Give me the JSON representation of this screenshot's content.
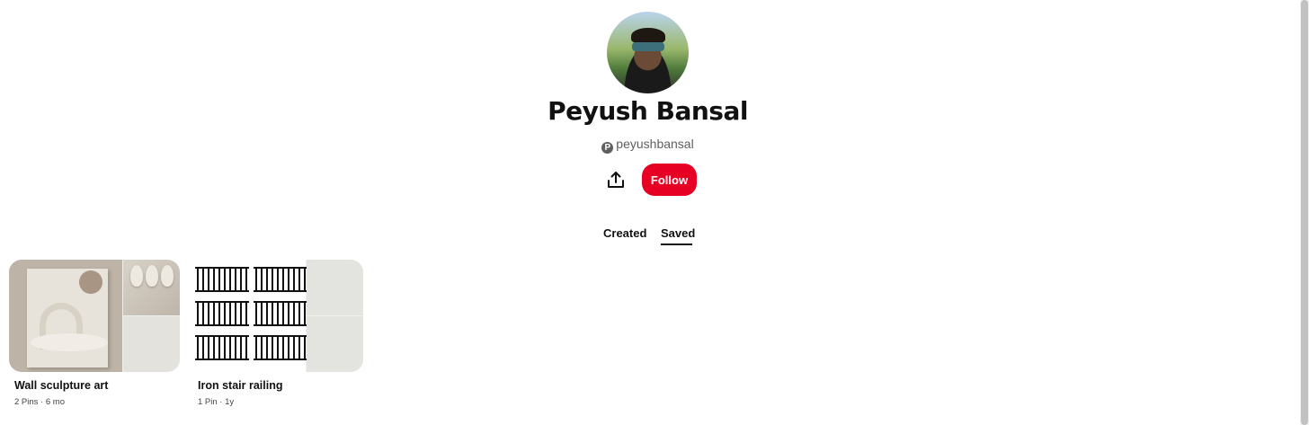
{
  "profile": {
    "name": "Peyush Bansal",
    "handle": "peyushbansal",
    "follow_label": "Follow"
  },
  "tabs": [
    {
      "label": "Created",
      "active": false
    },
    {
      "label": "Saved",
      "active": true
    }
  ],
  "boards": [
    {
      "title": "Wall sculpture art",
      "pins": "2 Pins",
      "age": "6 mo"
    },
    {
      "title": "Iron stair railing",
      "pins": "1 Pin",
      "age": "1y"
    }
  ],
  "meta_separator": "·",
  "colors": {
    "accent": "#e60023",
    "text": "#111111",
    "muted": "#5f5f5f"
  },
  "icons": {
    "share": "share-upload-icon",
    "brand": "pinterest-p-icon"
  }
}
